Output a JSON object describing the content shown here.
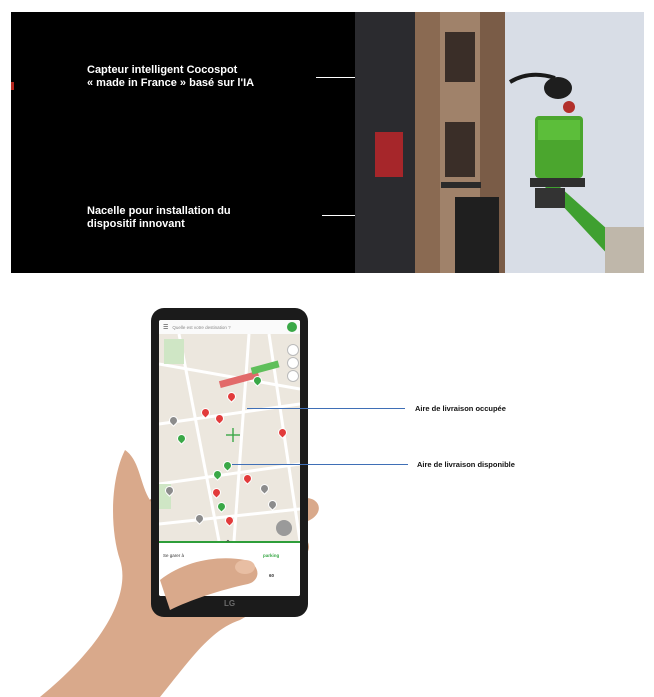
{
  "top_panel": {
    "caption_sensor": "Capteur intelligent Cocospot\n« made in France » basé sur l'IA",
    "caption_nacelle": "Nacelle pour installation du\ndispositif innovant"
  },
  "phone": {
    "search_placeholder": "Quelle est votre destination ?",
    "brand": "LG",
    "sheet_left": "Se garer à",
    "sheet_right": "parking",
    "sheet_value": "60"
  },
  "annotations": {
    "occupied": "Aire de livraison occupée",
    "available": "Aire de livraison disponible"
  },
  "colors": {
    "occupied": "#e23b3b",
    "available": "#3aa847",
    "neutral": "#8c8c8c",
    "annotation_line": "#3f6fb6"
  }
}
